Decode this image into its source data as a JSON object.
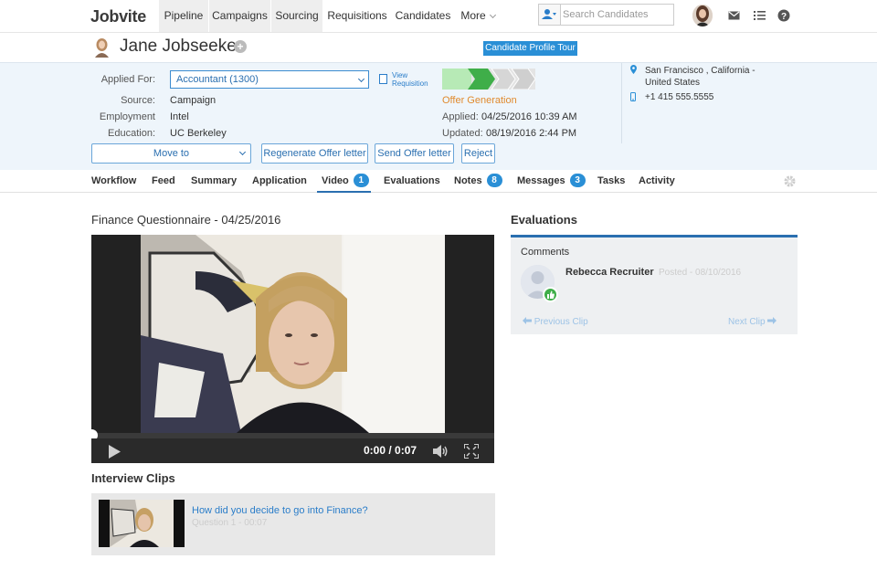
{
  "app": {
    "logo": "Jobvite"
  },
  "nav": {
    "items": [
      {
        "label": "Pipeline",
        "active": true
      },
      {
        "label": "Campaigns",
        "active": true
      },
      {
        "label": "Sourcing",
        "active": true
      },
      {
        "label": "Requisitions",
        "active": false
      },
      {
        "label": "Candidates",
        "active": false
      },
      {
        "label": "More",
        "active": false
      }
    ],
    "search_placeholder": "Search Candidates"
  },
  "candidate": {
    "name": "Jane Jobseeker",
    "tour_label": "Candidate Profile Tour"
  },
  "profile": {
    "applied_for_label": "Applied For:",
    "applied_for_value": "Accountant (1300)",
    "view_requisition_line1": "View",
    "view_requisition_line2": "Requisition",
    "source_label": "Source:",
    "source_value": "Campaign",
    "employment_label": "Employment",
    "employment_value": "Intel",
    "education_label": "Education:",
    "education_value": "UC Berkeley",
    "stage": "Offer Generation",
    "applied_label": "Applied:",
    "applied_value": "04/25/2016 10:39 AM",
    "updated_label": "Updated:",
    "updated_value": "08/19/2016 2:44 PM",
    "location_line1": "San Francisco , California -",
    "location_line2": "United States",
    "phone": "+1 415 555.5555",
    "pipeline_steps_done": 2,
    "pipeline_steps_total": 4
  },
  "actions": {
    "move_to": "Move to",
    "regenerate": "Regenerate Offer letter",
    "send": "Send Offer letter",
    "reject": "Reject"
  },
  "tabs": [
    {
      "label": "Workflow"
    },
    {
      "label": "Feed"
    },
    {
      "label": "Summary"
    },
    {
      "label": "Application"
    },
    {
      "label": "Video",
      "badge": "1",
      "active": true
    },
    {
      "label": "Evaluations"
    },
    {
      "label": "Notes",
      "badge": "8"
    },
    {
      "label": "Messages",
      "badge": "3"
    },
    {
      "label": "Tasks"
    },
    {
      "label": "Activity"
    }
  ],
  "video": {
    "title": "Finance Questionnaire  -  04/25/2016",
    "time": "0:00 / 0:07"
  },
  "clips": {
    "title": "Interview Clips",
    "items": [
      {
        "question": "How did you decide to go into Finance?",
        "meta": "Question 1 - 00:07"
      }
    ]
  },
  "evaluations": {
    "title": "Evaluations",
    "comments_label": "Comments",
    "reviewer": "Rebecca Recruiter",
    "posted": "Posted - 08/10/2016",
    "prev": "Previous Clip",
    "next": "Next Clip"
  },
  "colors": {
    "accent": "#2a8fd6",
    "stage": "#e08a2e",
    "thumbs": "#3fae49"
  }
}
